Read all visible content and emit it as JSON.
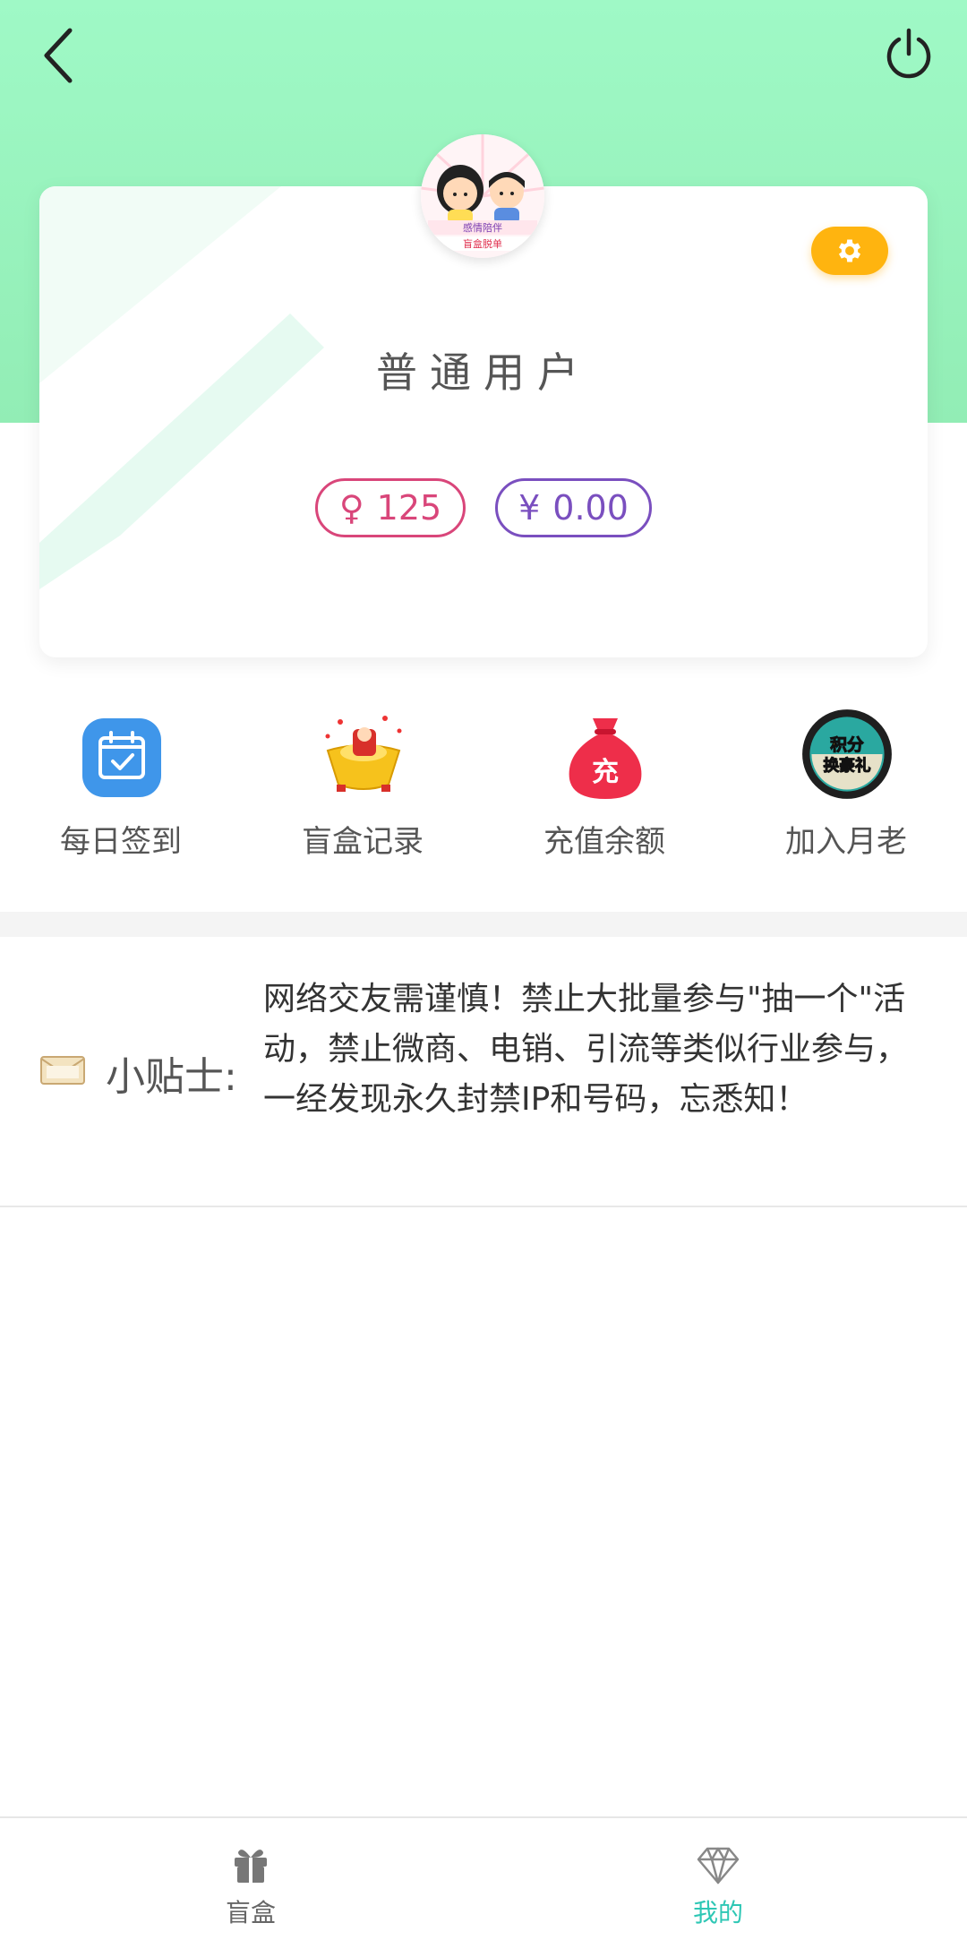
{
  "header": {
    "back_icon": "chevron-left-icon",
    "power_icon": "power-icon"
  },
  "profile": {
    "avatar_text_line1": "感情陪伴",
    "avatar_text_line2": "盲盒脱单",
    "settings_icon": "gear-icon",
    "username": "普通用户",
    "points": {
      "symbol": "♀",
      "value": "125"
    },
    "balance": {
      "symbol": "¥",
      "value": "0.00"
    }
  },
  "quick_menu": [
    {
      "label": "每日签到",
      "icon": "calendar-check-icon"
    },
    {
      "label": "盲盒记录",
      "icon": "gold-ingot-icon"
    },
    {
      "label": "充值余额",
      "icon": "money-bag-icon",
      "icon_text": "充"
    },
    {
      "label": "加入月老",
      "icon": "points-gift-badge-icon",
      "icon_text": "积分换豪礼"
    }
  ],
  "tip": {
    "icon": "envelope-icon",
    "label": "小贴士:",
    "text": "网络交友需谨慎！禁止大批量参与\"抽一个\"活动，禁止微商、电销、引流等类似行业参与，一经发现永久封禁IP和号码，忘悉知！"
  },
  "tabbar": [
    {
      "label": "盲盒",
      "icon": "gift-icon",
      "active": false
    },
    {
      "label": "我的",
      "icon": "diamond-icon",
      "active": true
    }
  ],
  "colors": {
    "header_green": "#9ff9c6",
    "accent_teal": "#2ec7b5",
    "settings_orange": "#ffb40f",
    "points_pink": "#d9467a",
    "balance_purple": "#7a4fbf"
  }
}
